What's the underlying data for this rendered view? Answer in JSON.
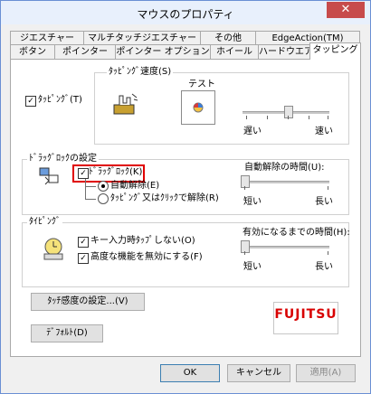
{
  "window": {
    "title": "マウスのプロパティ",
    "close_glyph": "✕"
  },
  "tabs_row1": [
    {
      "label": "ジエスチャー"
    },
    {
      "label": "マルチタッチジエスチャー"
    },
    {
      "label": "その他"
    },
    {
      "label": "EdgeAction(TM)"
    }
  ],
  "tabs_row2": [
    {
      "label": "ボタン"
    },
    {
      "label": "ポインター"
    },
    {
      "label": "ポインター オプション"
    },
    {
      "label": "ホイール"
    },
    {
      "label": "ハードウエア"
    },
    {
      "label": "タッピング",
      "active": true
    }
  ],
  "tapping": {
    "checkbox_label": "ﾀｯﾋﾟﾝｸﾞ(T)",
    "checked": true,
    "speed_group_label": "ﾀｯﾋﾟﾝｸﾞ速度(S)",
    "test_label": "テスト",
    "slider_min_label": "遅い",
    "slider_max_label": "速い",
    "slider_value_fraction": 0.5
  },
  "drag_lock": {
    "group_label": "ﾄﾞﾗｯｸﾞﾛｯｸの設定",
    "checkbox_label": "ﾄﾞﾗｯｸﾞﾛｯｸ(K)",
    "checked": true,
    "radio_auto_label": "自動解除(E)",
    "radio_auto_selected": true,
    "radio_click_label": "ﾀｯﾋﾟﾝｸﾞ又はｸﾘｯｸで解除(R)",
    "radio_click_selected": false,
    "time_label": "自動解除の時間(U):",
    "slider_min_label": "短い",
    "slider_max_label": "長い",
    "slider_value_fraction": 0.0
  },
  "typing": {
    "group_label": "ﾀｲﾋﾟﾝｸﾞ",
    "check1_label": "キー入力時ﾀｯﾌﾟしない(O)",
    "check1_checked": true,
    "check2_label": "高度な機能を無効にする(F)",
    "check2_checked": true,
    "time_label": "有効になるまでの時間(H):",
    "slider_min_label": "短い",
    "slider_max_label": "長い",
    "slider_value_fraction": 0.0
  },
  "buttons": {
    "touch_sensitivity": "ﾀｯﾁ感度の設定...(V)",
    "default": "ﾃﾞﾌｫﾙﾄ(D)",
    "ok": "OK",
    "cancel": "キャンセル",
    "apply": "適用(A)"
  },
  "logo": {
    "text": "FUJITSU"
  },
  "colors": {
    "highlight_box": "#e00000",
    "logo": "#d80000"
  }
}
